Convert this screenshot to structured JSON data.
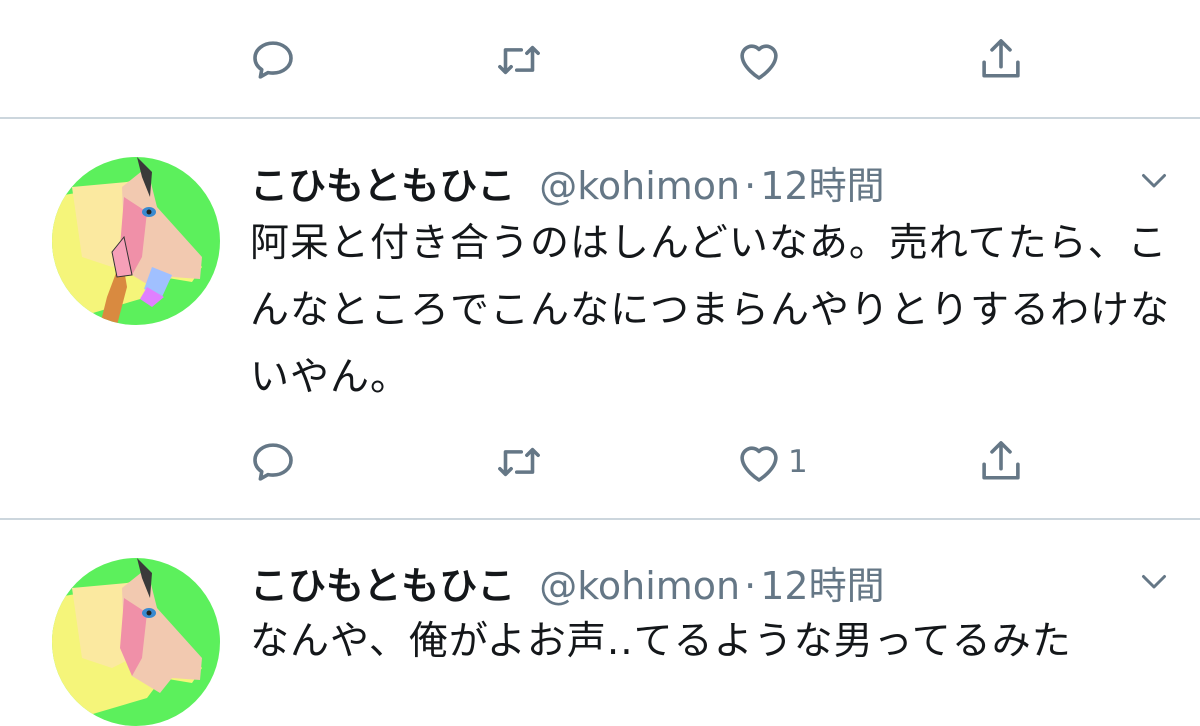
{
  "tweets": [
    {
      "name": "",
      "handle": "",
      "time": "",
      "text": "",
      "actions": {
        "reply_count": "",
        "retweet_count": "",
        "like_count": "",
        "share": "share"
      }
    },
    {
      "name": "こひもともひこ",
      "handle": "@kohimon",
      "separator": "·",
      "time": "12時間",
      "text": "阿呆と付き合うのはしんどいなあ。売れてたら、こんなところでこんなにつまらんやりとりするわけないやん。",
      "actions": {
        "reply_count": "",
        "retweet_count": "",
        "like_count": "1"
      }
    },
    {
      "name": "こひもともひこ",
      "handle": "@kohimon",
      "separator": "·",
      "time": "12時間",
      "text": "なんや、俺がよお声..てるような男ってるみた"
    }
  ],
  "colors": {
    "icon_gray": "#657786",
    "divider": "#ccd6dd",
    "text": "#14171a",
    "avatar_bg": "#5cf05c"
  },
  "icons": [
    "reply-icon",
    "retweet-icon",
    "like-icon",
    "share-icon",
    "chevron-down-icon"
  ]
}
